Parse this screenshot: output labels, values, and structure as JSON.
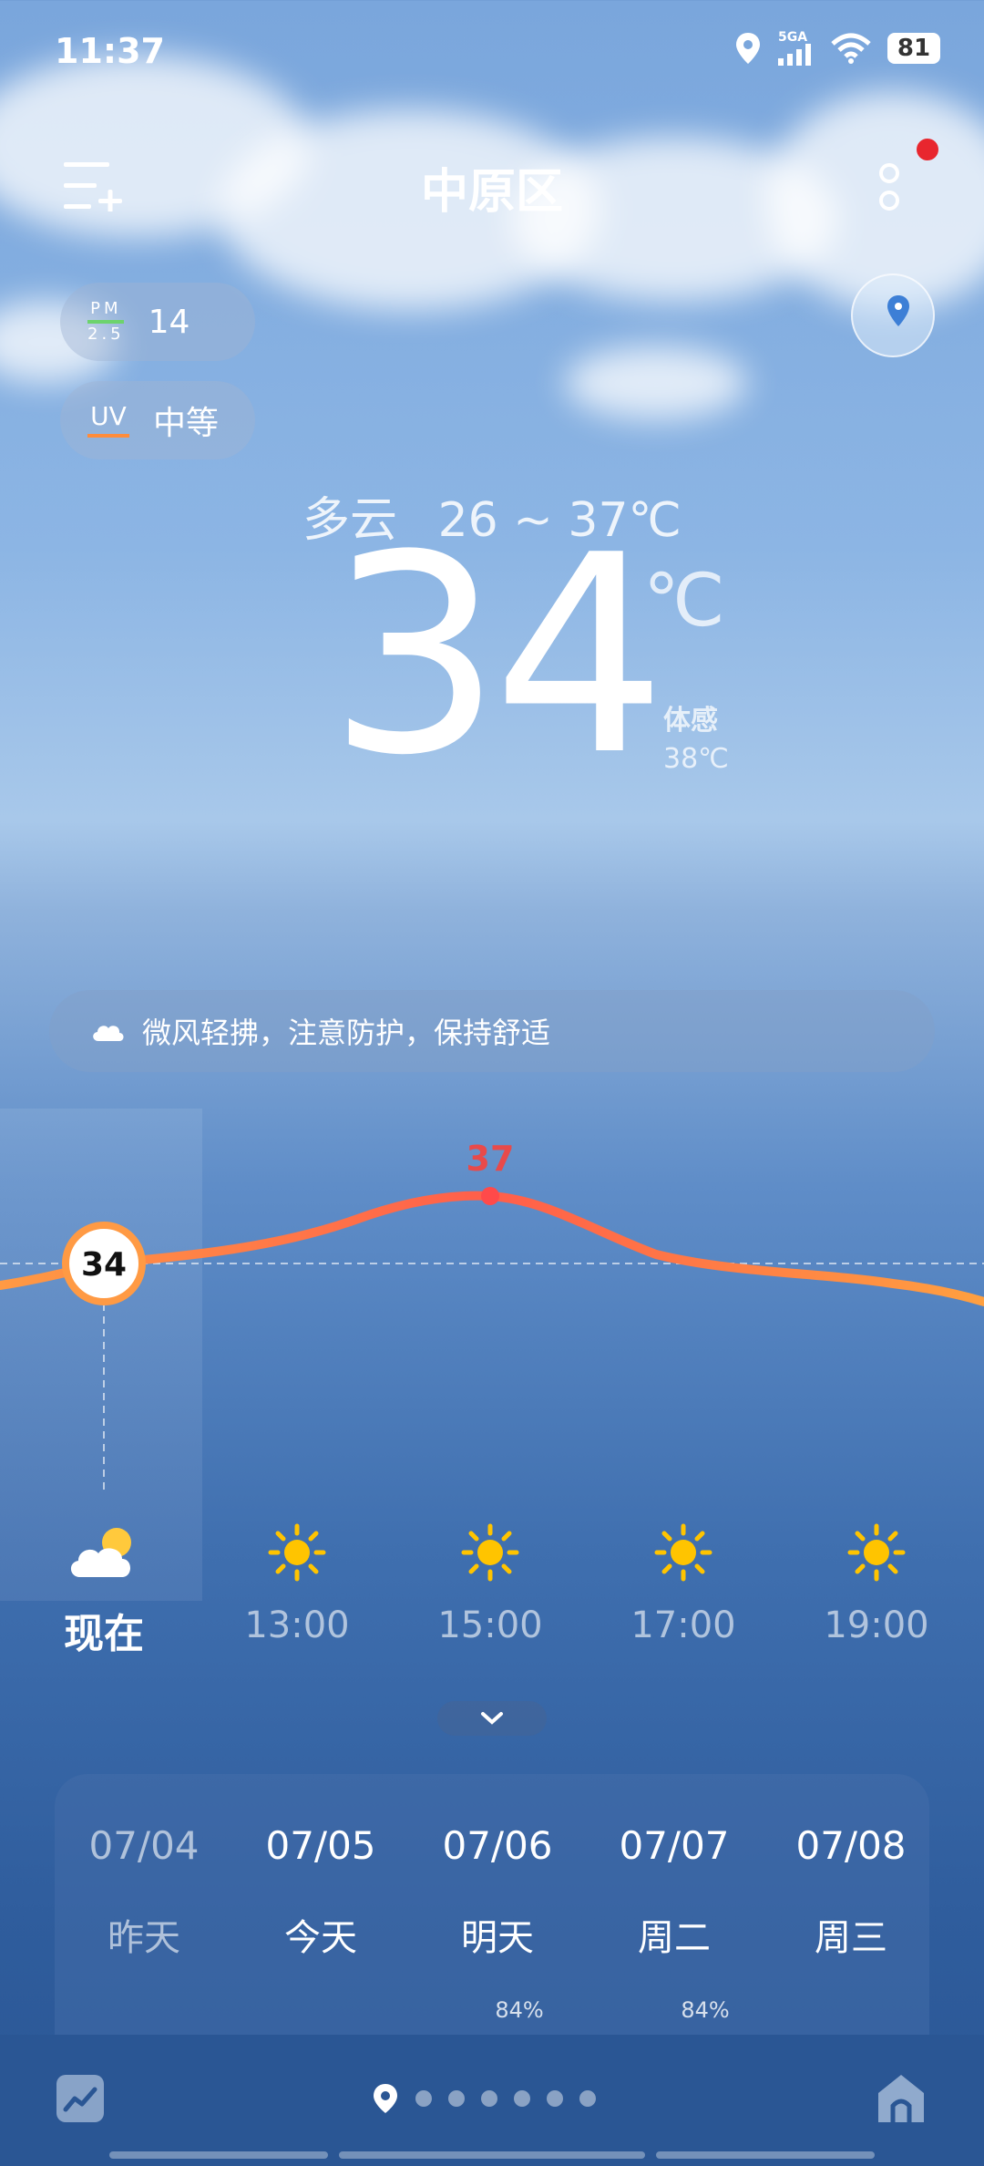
{
  "status": {
    "time": "11:37",
    "network": "5GA",
    "battery": "81"
  },
  "header": {
    "city": "中原区"
  },
  "air": {
    "pm_top": "PM",
    "pm_bottom": "2.5",
    "pm_value": "14",
    "uv_label": "UV",
    "uv_value": "中等"
  },
  "current": {
    "condition": "多云",
    "range": "26 ~ 37℃",
    "temp": "34",
    "unit": "℃",
    "feels_label": "体感",
    "feels_value": "38℃"
  },
  "banner": {
    "text": "微风轻拂，注意防护，保持舒适"
  },
  "hourly": {
    "now_temp": "34",
    "peak_label": "37",
    "items": [
      {
        "time": "现在",
        "icon": "partly-cloudy-icon"
      },
      {
        "time": "13:00",
        "icon": "sun-icon"
      },
      {
        "time": "15:00",
        "icon": "sun-icon"
      },
      {
        "time": "17:00",
        "icon": "sun-icon"
      },
      {
        "time": "19:00",
        "icon": "sun-icon"
      }
    ]
  },
  "daily": {
    "items": [
      {
        "date": "07/04",
        "name": "昨天"
      },
      {
        "date": "07/05",
        "name": "今天"
      },
      {
        "date": "07/06",
        "name": "明天",
        "pct": "84%"
      },
      {
        "date": "07/07",
        "name": "周二",
        "pct": "84%"
      },
      {
        "date": "07/08",
        "name": "周三"
      }
    ]
  },
  "colors": {
    "temp_line": "#ff7a45",
    "peak": "#e84a4a",
    "accent_red": "#e8262e"
  }
}
